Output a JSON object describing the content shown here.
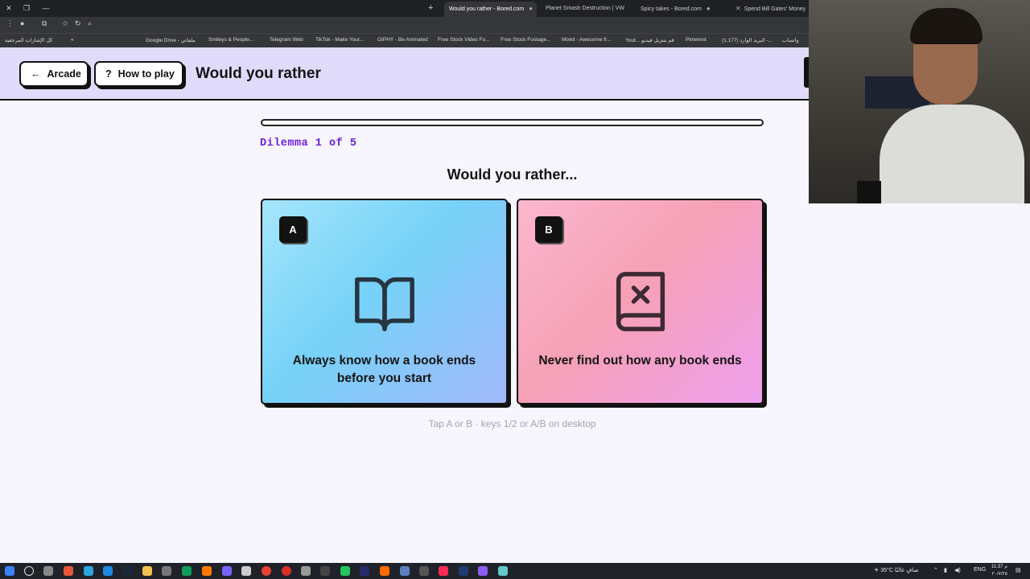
{
  "browser": {
    "new_tab_label": "+",
    "tabs": [
      {
        "title": "Would you rather - Bored.com",
        "active": true
      },
      {
        "title": "Planet Smash Destruction | VW"
      },
      {
        "title": "Spicy takes - Bored.com"
      },
      {
        "title": "Spend Bill Gates' Money"
      }
    ],
    "bookmarks": [
      "Google Drive - ملفاتي",
      "Smileys & People...",
      "Telegram Web",
      "TikTok - Make Your...",
      "GIPHY - Be Animated",
      "Free Stock Video Fo...",
      "Free Stock Footage...",
      "Mixkit - Awesome fr...",
      "Yout... قم بتنزيل فيديو",
      "Pinterest",
      "(1,177) البريد الوارد -...",
      "واتساب"
    ],
    "bookmarks_folder": "كل الإشارات المرجعية"
  },
  "header": {
    "arcade_label": "Arcade",
    "arcade_icon": "←",
    "howto_label": "How to play",
    "howto_icon": "?",
    "title": "Would you rather"
  },
  "game": {
    "progress_fraction": 0.0,
    "counter": "Dilemma 1 of 5",
    "question": "Would you rather...",
    "option_a": {
      "key": "A",
      "text": "Always know how a book ends before you start",
      "icon": "open-book-icon"
    },
    "option_b": {
      "key": "B",
      "text": "Never find out how any book ends",
      "icon": "book-x-icon"
    },
    "hint": "Tap A or B · keys 1/2 or A/B on desktop"
  },
  "taskbar": {
    "weather": "35°C صافٍ غالبًا",
    "lang": "ENG",
    "time": "11:37 م",
    "date": "٢٠/٧/٢٥"
  },
  "colors": {
    "header_bg": "#e0dbfb",
    "counter": "#6b21d8",
    "card_a": "#76d2f8",
    "card_b": "#f6a1b6"
  }
}
